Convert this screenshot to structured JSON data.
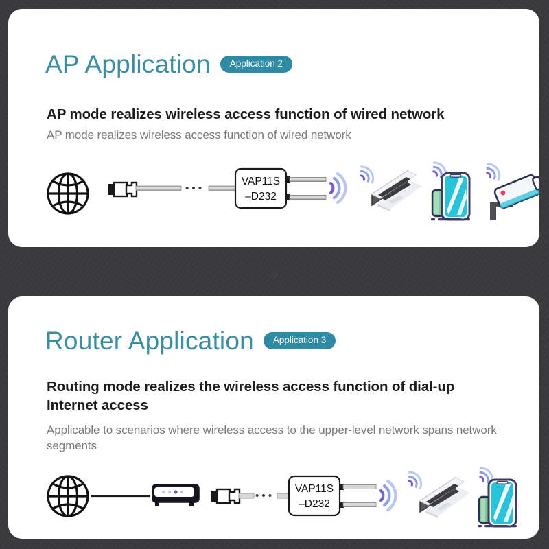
{
  "background": {
    "color": "#3b3b3d",
    "texture": "dark-speckled-fabric"
  },
  "theme": {
    "teal": "#3a8da3",
    "badge_bg": "#2f8aa3",
    "subtitle_color": "#1c1c1e",
    "desc_color": "#7a7a7e",
    "wifi_purple": "#7b5fd6",
    "wifi_purple_light": "#a9b7ef",
    "phone_screen": "#29c3d9",
    "laptop_body": "#4a4a4f",
    "card_bg": "#ffffff"
  },
  "panels": [
    {
      "id": "ap-application",
      "title": "AP Application",
      "badge": "Application 2",
      "subtitle": "AP mode realizes wireless access function of wired network",
      "description": "AP mode realizes wireless access function of wired network",
      "diagram": {
        "device_label_line1": "VAP11S",
        "device_label_line2": "–D232",
        "cable_ellipsis": "• • •",
        "nodes": [
          {
            "name": "globe-icon",
            "label": "Internet"
          },
          {
            "name": "rj45-connector-icon",
            "label": "RJ45 Ethernet connector"
          },
          {
            "name": "ethernet-cable",
            "label": "Ethernet cable"
          },
          {
            "name": "vap11s-device",
            "label": "VAP11S-D232 wireless bridge"
          },
          {
            "name": "wifi-signal-icon",
            "label": "Wi-Fi signal"
          },
          {
            "name": "laptop-icon",
            "label": "Laptop client"
          },
          {
            "name": "smartphone-icon",
            "label": "Smartphone client"
          },
          {
            "name": "security-camera-icon",
            "label": "IP security camera client"
          }
        ]
      }
    },
    {
      "id": "router-application",
      "title": "Router Application",
      "badge": "Application 3",
      "subtitle": "Routing mode realizes the wireless access function of dial-up Internet access",
      "description": "Applicable to scenarios where wireless access to the upper-level network spans network segments",
      "diagram": {
        "device_label_line1": "VAP11S",
        "device_label_line2": "–D232",
        "cable_ellipsis": "• • •",
        "nodes": [
          {
            "name": "globe-icon",
            "label": "Internet"
          },
          {
            "name": "modem-icon",
            "label": "Broadband modem / router"
          },
          {
            "name": "rj45-connector-icon",
            "label": "RJ45 Ethernet connector"
          },
          {
            "name": "ethernet-cable",
            "label": "Ethernet cable"
          },
          {
            "name": "vap11s-device",
            "label": "VAP11S-D232 wireless bridge"
          },
          {
            "name": "wifi-signal-icon",
            "label": "Wi-Fi signal"
          },
          {
            "name": "laptop-icon",
            "label": "Laptop client"
          },
          {
            "name": "smartphone-icon",
            "label": "Smartphone client"
          }
        ]
      }
    }
  ]
}
